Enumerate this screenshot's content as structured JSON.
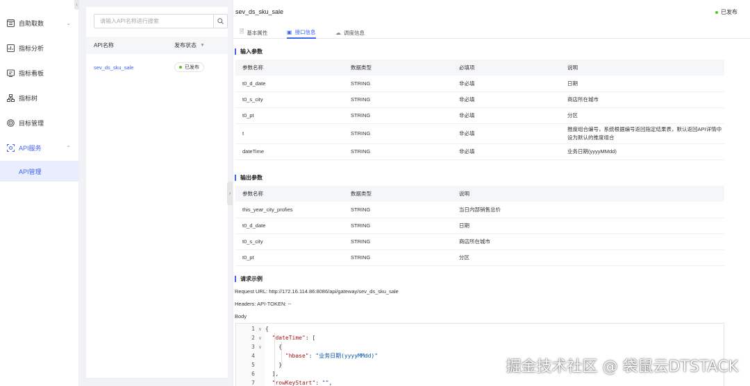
{
  "sidebar": {
    "items": [
      {
        "label": "自助取数",
        "icon": "grid-icon",
        "has_chevron": true
      },
      {
        "label": "指标分析",
        "icon": "bar-chart-icon"
      },
      {
        "label": "指标看板",
        "icon": "dashboard-icon"
      },
      {
        "label": "指标树",
        "icon": "tree-icon"
      },
      {
        "label": "目标管理",
        "icon": "target-icon"
      },
      {
        "label": "API服务",
        "icon": "api-icon",
        "has_chevron": true,
        "expanded": true
      }
    ],
    "sub_item": {
      "label": "API管理"
    }
  },
  "list": {
    "search_placeholder": "请输入API名称进行搜索",
    "col_name": "API名称",
    "col_status": "发布状态",
    "rows": [
      {
        "name": "sev_ds_sku_sale",
        "status": "已发布"
      }
    ]
  },
  "detail": {
    "title": "sev_ds_sku_sale",
    "status": "已发布",
    "tabs": [
      {
        "label": "基本属性",
        "icon": "document-icon"
      },
      {
        "label": "接口信息",
        "icon": "interface-icon",
        "active": true
      },
      {
        "label": "调度信息",
        "icon": "cloud-icon"
      }
    ],
    "input_section": "输入参数",
    "input_headers": [
      "参数名称",
      "数据类型",
      "必填项",
      "说明"
    ],
    "input_rows": [
      [
        "t0_d_date",
        "STRING",
        "非必填",
        "日期"
      ],
      [
        "t0_s_city",
        "STRING",
        "非必填",
        "商店所在城市"
      ],
      [
        "t0_pt",
        "STRING",
        "非必填",
        "分区"
      ],
      [
        "t",
        "STRING",
        "非必填",
        "推度组合编号，系统根据编号返回指定结果表，默认返回API详情中设为默认的推度组合"
      ],
      [
        "dateTime",
        "STRING",
        "非必填",
        "业务日期(yyyyMMdd)"
      ]
    ],
    "output_section": "输出参数",
    "output_headers": [
      "参数名称",
      "数据类型",
      "说明"
    ],
    "output_rows": [
      [
        "this_year_city_profies",
        "STRING",
        "当日内部销售总价"
      ],
      [
        "t0_d_date",
        "STRING",
        "日期"
      ],
      [
        "t0_s_city",
        "STRING",
        "商店所在城市"
      ],
      [
        "t0_pt",
        "STRING",
        "分区"
      ]
    ],
    "request_section": "请求示例",
    "request_url": "Request URL: http://172.16.114.86:8086/api/gateway/sev_ds_sku_sale",
    "headers": "Headers: API-TOKEN: --",
    "body_label": "Body",
    "code_lines": [
      {
        "n": "1",
        "fold": "∨",
        "text": "{"
      },
      {
        "n": "2",
        "fold": "∨",
        "key": "\"dateTime\"",
        "rest": ": ["
      },
      {
        "n": "3",
        "fold": "∨",
        "text": "    {"
      },
      {
        "n": "4",
        "fold": "",
        "key": "\"hbase\"",
        "rest": ": ",
        "str": "\"业务日期(yyyyMMdd)\"",
        "indent": "      "
      },
      {
        "n": "5",
        "fold": "",
        "text": "    }"
      },
      {
        "n": "6",
        "fold": "",
        "text": "  ],"
      },
      {
        "n": "7",
        "fold": "",
        "key": "\"rowKeyStart\"",
        "rest": ": ",
        "str": "\"\"",
        "tail": ","
      }
    ]
  },
  "watermark": "掘金技术社区 @ 袋鼠云DTSTACK",
  "colors": {
    "accent": "#3f62f4",
    "success": "#52c41a"
  }
}
